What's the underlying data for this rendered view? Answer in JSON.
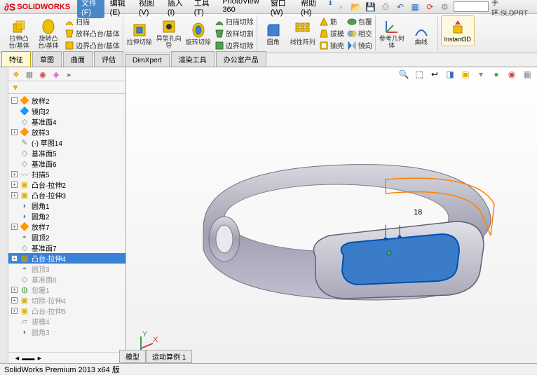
{
  "app": {
    "name": "SOLIDWORKS",
    "filename": "手环.SLDPRT",
    "status": "SolidWorks Premium 2013 x64 版"
  },
  "menu": {
    "file": "文件(F)",
    "items": [
      "编辑(E)",
      "视图(V)",
      "插入(I)",
      "工具(T)",
      "PhotoView 360",
      "窗口(W)",
      "帮助(H)"
    ]
  },
  "ribbon": {
    "extrude_boss": "拉伸凸台/基体",
    "revolve_boss": "旋转凸台/基体",
    "sweep": "扫描",
    "loft": "放样凸台/基体",
    "boundary": "边界凸台/基体",
    "extrude_cut": "拉伸切除",
    "hole": "异型孔向导",
    "revolve_cut": "旋转切除",
    "sweep_cut": "扫描切除",
    "loft_cut": "放样切割",
    "boundary_cut": "边界切除",
    "fillet": "圆角",
    "pattern": "线性阵列",
    "rib": "筋",
    "draft": "拔模",
    "shell": "抽壳",
    "wrap": "包覆",
    "intersect": "相交",
    "mirror": "镜向",
    "geometry": "参考几何体",
    "curves": "曲线",
    "instant3d": "Instant3D"
  },
  "tabs": [
    "特征",
    "草图",
    "曲面",
    "评估",
    "DimXpert",
    "渲染工具",
    "办公室产品"
  ],
  "active_tab": "特征",
  "tree": [
    {
      "exp": "-",
      "icon": "loft",
      "label": "放样2"
    },
    {
      "exp": "",
      "icon": "mirror",
      "label": "镜向2"
    },
    {
      "exp": "",
      "icon": "plane",
      "label": "基准面4"
    },
    {
      "exp": "+",
      "icon": "loft",
      "label": "放样3"
    },
    {
      "exp": "",
      "icon": "sketch",
      "label": "(-) 草图14"
    },
    {
      "exp": "",
      "icon": "plane",
      "label": "基准面5"
    },
    {
      "exp": "",
      "icon": "plane",
      "label": "基准面6"
    },
    {
      "exp": "+",
      "icon": "sweep",
      "label": "扫描5"
    },
    {
      "exp": "+",
      "icon": "cut",
      "label": "凸台-拉伸2"
    },
    {
      "exp": "+",
      "icon": "cut",
      "label": "凸台-拉伸3"
    },
    {
      "exp": "",
      "icon": "fillet",
      "label": "圆角1"
    },
    {
      "exp": "",
      "icon": "fillet",
      "label": "圆角2"
    },
    {
      "exp": "+",
      "icon": "loft",
      "label": "放样7"
    },
    {
      "exp": "",
      "icon": "dome",
      "label": "圆顶2"
    },
    {
      "exp": "",
      "icon": "plane",
      "label": "基准面7"
    },
    {
      "exp": "+",
      "icon": "extrude",
      "label": "凸台-拉伸4",
      "sel": true
    },
    {
      "exp": "",
      "icon": "dome",
      "label": "圆顶3",
      "dim": true
    },
    {
      "exp": "",
      "icon": "plane",
      "label": "基准面8",
      "dim": true
    },
    {
      "exp": "+",
      "icon": "wrap",
      "label": "包覆1",
      "dim": true
    },
    {
      "exp": "+",
      "icon": "cut",
      "label": "切除-拉伸4",
      "dim": true
    },
    {
      "exp": "+",
      "icon": "cut",
      "label": "凸台-拉伸5",
      "dim": true
    },
    {
      "exp": "",
      "icon": "draft",
      "label": "拔模4",
      "dim": true
    },
    {
      "exp": "",
      "icon": "fillet",
      "label": "圆角3",
      "dim": true
    }
  ],
  "bottom_tabs": [
    "模型",
    "运动算例 1"
  ],
  "dim_label": "18"
}
